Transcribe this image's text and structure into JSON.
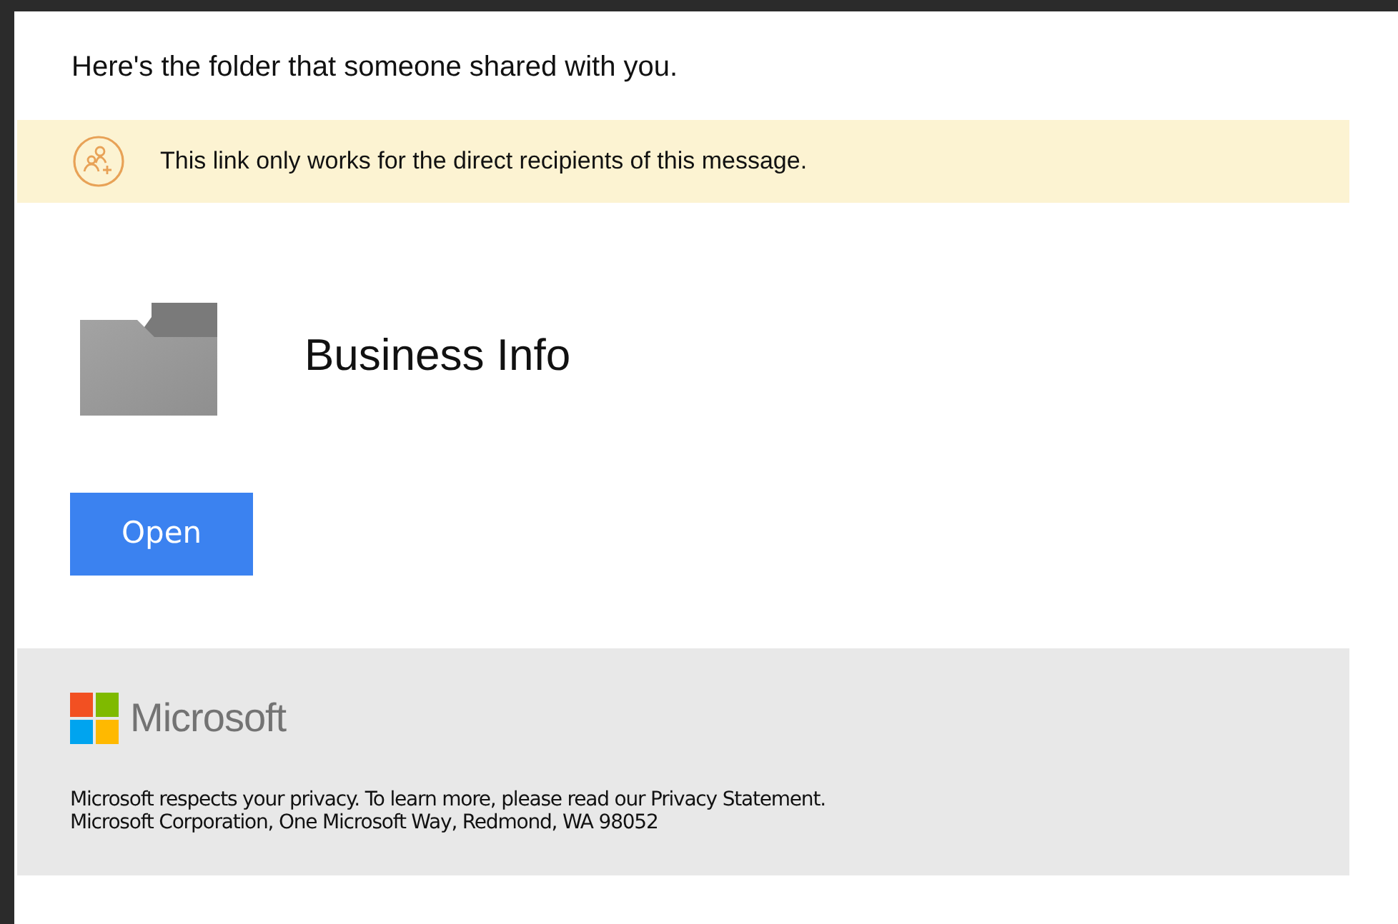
{
  "heading": "Here's the folder that someone shared with you.",
  "notice": {
    "text": "This link only works for the direct recipients of this message."
  },
  "folder": {
    "name": "Business Info"
  },
  "open_button": "Open",
  "footer": {
    "brand": "Microsoft",
    "lines": [
      "Microsoft respects your privacy. To learn more, please read our Privacy Statement.",
      "Microsoft Corporation, One Microsoft Way, Redmond, WA 98052"
    ]
  }
}
